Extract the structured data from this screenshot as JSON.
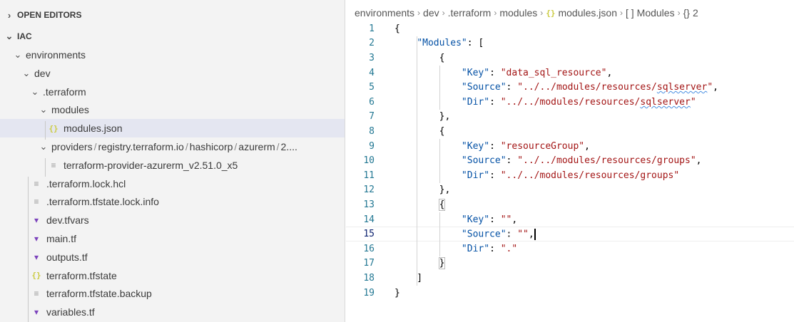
{
  "explorer": {
    "open_editors": "OPEN EDITORS",
    "workspace": "IAC",
    "tree": [
      {
        "label": "environments",
        "type": "folder",
        "level": 1
      },
      {
        "label": "dev",
        "type": "folder",
        "level": 2
      },
      {
        "label": ".terraform",
        "type": "folder",
        "level": 3
      },
      {
        "label": "modules",
        "type": "folder",
        "level": 4
      },
      {
        "label": "modules.json",
        "type": "json",
        "level": 5,
        "selected": true
      },
      {
        "label": "providers",
        "type": "folder",
        "level": 4,
        "path_parts": [
          "registry.terraform.io",
          "hashicorp",
          "azurerm",
          "2...."
        ]
      },
      {
        "label": "terraform-provider-azurerm_v2.51.0_x5",
        "type": "text",
        "level": 5
      },
      {
        "label": ".terraform.lock.hcl",
        "type": "text",
        "level": 3
      },
      {
        "label": ".terraform.tfstate.lock.info",
        "type": "text",
        "level": 3
      },
      {
        "label": "dev.tfvars",
        "type": "terraform",
        "level": 3
      },
      {
        "label": "main.tf",
        "type": "terraform",
        "level": 3
      },
      {
        "label": "outputs.tf",
        "type": "terraform",
        "level": 3
      },
      {
        "label": "terraform.tfstate",
        "type": "json",
        "level": 3
      },
      {
        "label": "terraform.tfstate.backup",
        "type": "text",
        "level": 3
      },
      {
        "label": "variables.tf",
        "type": "terraform",
        "level": 3
      }
    ]
  },
  "breadcrumb": {
    "items": [
      "environments",
      "dev",
      ".terraform",
      "modules"
    ],
    "file": "modules.json",
    "tail": [
      "Modules",
      "2"
    ]
  },
  "code": {
    "current_line": 15,
    "lines": [
      {
        "n": "1",
        "tokens": [
          {
            "t": "{",
            "c": "p"
          }
        ]
      },
      {
        "n": "2",
        "tokens": [
          {
            "t": "    ",
            "c": "p"
          },
          {
            "t": "\"Modules\"",
            "c": "key"
          },
          {
            "t": ": [",
            "c": "p"
          }
        ]
      },
      {
        "n": "3",
        "tokens": [
          {
            "t": "        {",
            "c": "p"
          }
        ]
      },
      {
        "n": "4",
        "tokens": [
          {
            "t": "            ",
            "c": "p"
          },
          {
            "t": "\"Key\"",
            "c": "key"
          },
          {
            "t": ": ",
            "c": "p"
          },
          {
            "t": "\"data_sql_resource\"",
            "c": "str"
          },
          {
            "t": ",",
            "c": "p"
          }
        ]
      },
      {
        "n": "5",
        "tokens": [
          {
            "t": "            ",
            "c": "p"
          },
          {
            "t": "\"Source\"",
            "c": "key"
          },
          {
            "t": ": ",
            "c": "p"
          },
          {
            "t": "\"../../modules/resources/",
            "c": "str"
          },
          {
            "t": "sqlserver",
            "c": "str squig"
          },
          {
            "t": "\"",
            "c": "str"
          },
          {
            "t": ",",
            "c": "p"
          }
        ]
      },
      {
        "n": "6",
        "tokens": [
          {
            "t": "            ",
            "c": "p"
          },
          {
            "t": "\"Dir\"",
            "c": "key"
          },
          {
            "t": ": ",
            "c": "p"
          },
          {
            "t": "\"../../modules/resources/",
            "c": "str"
          },
          {
            "t": "sqlserver",
            "c": "str squig"
          },
          {
            "t": "\"",
            "c": "str"
          }
        ]
      },
      {
        "n": "7",
        "tokens": [
          {
            "t": "        },",
            "c": "p"
          }
        ]
      },
      {
        "n": "8",
        "tokens": [
          {
            "t": "        {",
            "c": "p"
          }
        ]
      },
      {
        "n": "9",
        "tokens": [
          {
            "t": "            ",
            "c": "p"
          },
          {
            "t": "\"Key\"",
            "c": "key"
          },
          {
            "t": ": ",
            "c": "p"
          },
          {
            "t": "\"resourceGroup\"",
            "c": "str"
          },
          {
            "t": ",",
            "c": "p"
          }
        ]
      },
      {
        "n": "10",
        "tokens": [
          {
            "t": "            ",
            "c": "p"
          },
          {
            "t": "\"Source\"",
            "c": "key"
          },
          {
            "t": ": ",
            "c": "p"
          },
          {
            "t": "\"../../modules/resources/groups\"",
            "c": "str"
          },
          {
            "t": ",",
            "c": "p"
          }
        ]
      },
      {
        "n": "11",
        "tokens": [
          {
            "t": "            ",
            "c": "p"
          },
          {
            "t": "\"Dir\"",
            "c": "key"
          },
          {
            "t": ": ",
            "c": "p"
          },
          {
            "t": "\"../../modules/resources/groups\"",
            "c": "str"
          }
        ]
      },
      {
        "n": "12",
        "tokens": [
          {
            "t": "        },",
            "c": "p"
          }
        ]
      },
      {
        "n": "13",
        "tokens": [
          {
            "t": "        ",
            "c": "p"
          },
          {
            "t": "{",
            "c": "p bracket"
          }
        ]
      },
      {
        "n": "14",
        "tokens": [
          {
            "t": "            ",
            "c": "p"
          },
          {
            "t": "\"Key\"",
            "c": "key"
          },
          {
            "t": ": ",
            "c": "p"
          },
          {
            "t": "\"\"",
            "c": "str"
          },
          {
            "t": ",",
            "c": "p"
          }
        ]
      },
      {
        "n": "15",
        "tokens": [
          {
            "t": "            ",
            "c": "p"
          },
          {
            "t": "\"Source\"",
            "c": "key"
          },
          {
            "t": ": ",
            "c": "p"
          },
          {
            "t": "\"\"",
            "c": "str"
          },
          {
            "t": ",",
            "c": "p"
          }
        ]
      },
      {
        "n": "16",
        "tokens": [
          {
            "t": "            ",
            "c": "p"
          },
          {
            "t": "\"Dir\"",
            "c": "key"
          },
          {
            "t": ": ",
            "c": "p"
          },
          {
            "t": "\".\"",
            "c": "str"
          }
        ]
      },
      {
        "n": "17",
        "tokens": [
          {
            "t": "        ",
            "c": "p"
          },
          {
            "t": "}",
            "c": "p bracket"
          }
        ]
      },
      {
        "n": "18",
        "tokens": [
          {
            "t": "    ]",
            "c": "p"
          }
        ]
      },
      {
        "n": "19",
        "tokens": [
          {
            "t": "}",
            "c": "p"
          }
        ]
      }
    ]
  }
}
